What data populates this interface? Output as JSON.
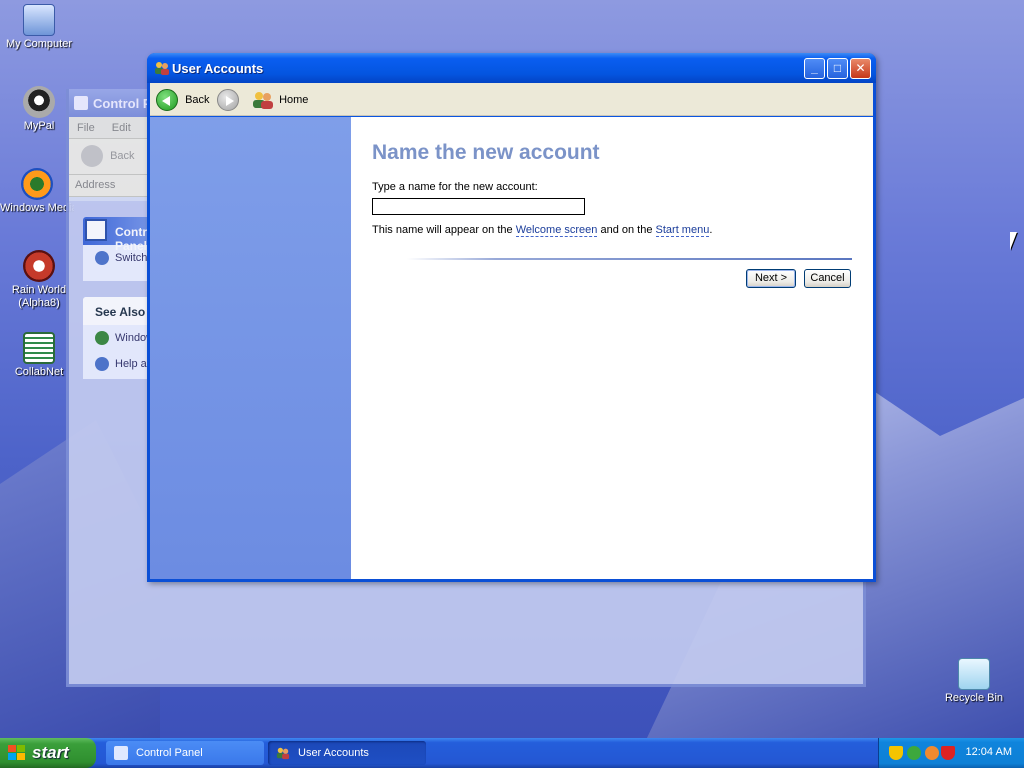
{
  "desktop": {
    "icons": [
      {
        "label": "My Computer"
      },
      {
        "label": "MyPal"
      },
      {
        "label": "Windows Media Player"
      },
      {
        "label": "Rain World (Alpha8)"
      },
      {
        "label": "CollabNet"
      },
      {
        "label": "Recycle Bin"
      }
    ]
  },
  "control_panel": {
    "title": "Control Panel",
    "menu": {
      "file": "File",
      "edit": "Edit"
    },
    "back": "Back",
    "address": "Address",
    "task_pane_title": "Control Panel",
    "task_link": "Switch to Classic View",
    "see_also_title": "See Also",
    "see_also_items": [
      "Windows Update",
      "Help and Support"
    ]
  },
  "window": {
    "title": "User Accounts",
    "toolbar": {
      "back": "Back",
      "home": "Home"
    },
    "buttons": {
      "minimize": "_",
      "maximize": "□",
      "close": "✕"
    }
  },
  "content": {
    "heading": "Name the new account",
    "prompt": "Type a name for the new account:",
    "input_value": "",
    "note_prefix": "This name will appear on the ",
    "welcome_link": "Welcome screen",
    "note_middle": " and on the ",
    "start_link": "Start menu",
    "note_suffix": ".",
    "next_button": "Next >",
    "cancel_button": "Cancel"
  },
  "taskbar": {
    "start": "start",
    "tasks": [
      {
        "label": "Control Panel"
      },
      {
        "label": "User Accounts"
      }
    ],
    "clock": "12:04 AM"
  }
}
